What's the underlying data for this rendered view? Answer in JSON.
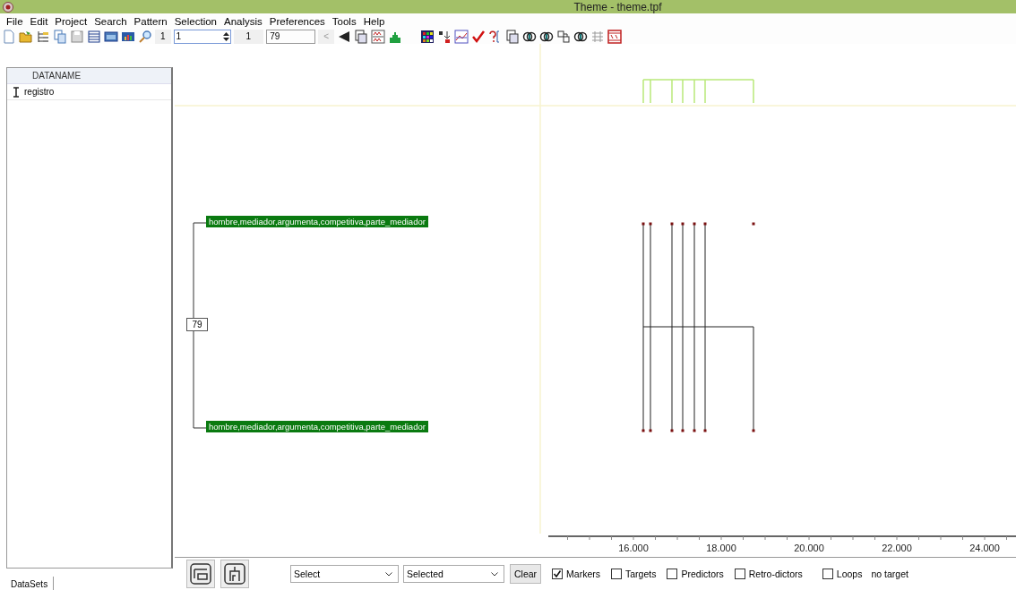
{
  "window": {
    "title": "Theme - theme.tpf"
  },
  "menu": [
    "File",
    "Edit",
    "Project",
    "Search",
    "Pattern",
    "Selection",
    "Analysis",
    "Preferences",
    "Tools",
    "Help"
  ],
  "toolbar": {
    "button_1": "1",
    "spin_value": "1",
    "button_2": "1",
    "field_value": "79",
    "prev_button": "<"
  },
  "datasets": {
    "columns": [
      "DATANAME"
    ],
    "rows": [
      {
        "dataname": "registro"
      }
    ],
    "tab": "DataSets"
  },
  "pattern_tree": {
    "node": "79",
    "branches": [
      "hombre,mediador,argumenta,competitiva,parte_mediador",
      "hombre,mediador,argumenta,competitiva,parte_mediador"
    ]
  },
  "timeline": {
    "tick_labels": [
      "16.000",
      "18.000",
      "20.000",
      "22.000",
      "24.000"
    ]
  },
  "controls": {
    "selects": [
      {
        "value": "Select"
      },
      {
        "value": "Selected"
      }
    ],
    "clear_button": "Clear",
    "checkboxes": [
      {
        "label": "Markers",
        "checked": true
      },
      {
        "label": "Targets",
        "checked": false
      },
      {
        "label": "Predictors",
        "checked": false
      },
      {
        "label": "Retro-dictors",
        "checked": false
      },
      {
        "label": "Loops",
        "checked": false
      }
    ],
    "target_status": "no target"
  }
}
